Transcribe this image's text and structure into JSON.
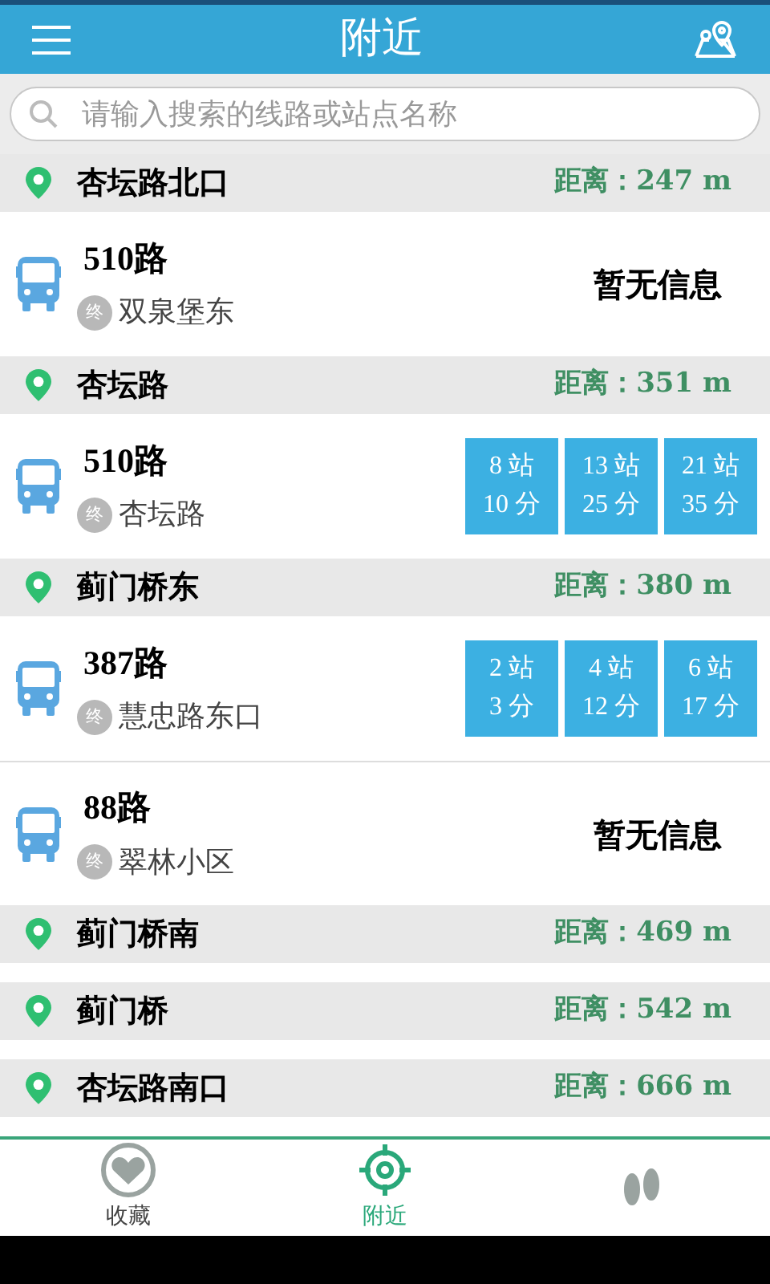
{
  "header": {
    "title": "附近"
  },
  "search": {
    "placeholder": "请输入搜索的线路或站点名称"
  },
  "stations": [
    {
      "name": "杏坛路北口",
      "distance": "距离：247 m",
      "routes": [
        {
          "kind": "text",
          "name": "510路",
          "end_badge": "终",
          "terminus": "双泉堡东",
          "message": "暂无信息"
        }
      ]
    },
    {
      "name": "杏坛路",
      "distance": "距离：351 m",
      "routes": [
        {
          "kind": "eta",
          "name": "510路",
          "end_badge": "终",
          "terminus": "杏坛路",
          "etas": [
            {
              "stops": "8 站",
              "time": "10 分"
            },
            {
              "stops": "13 站",
              "time": "25 分"
            },
            {
              "stops": "21 站",
              "time": "35 分"
            }
          ]
        }
      ]
    },
    {
      "name": "蓟门桥东",
      "distance": "距离：380 m",
      "routes": [
        {
          "kind": "eta",
          "name": "387路",
          "end_badge": "终",
          "terminus": "慧忠路东口",
          "etas": [
            {
              "stops": "2 站",
              "time": "3 分"
            },
            {
              "stops": "4 站",
              "time": "12 分"
            },
            {
              "stops": "6 站",
              "time": "17 分"
            }
          ]
        },
        {
          "kind": "text",
          "name": "88路",
          "end_badge": "终",
          "terminus": "翠林小区",
          "message": "暂无信息"
        }
      ]
    },
    {
      "name": "蓟门桥南",
      "distance": "距离：469 m"
    },
    {
      "name": "蓟门桥",
      "distance": "距离：542 m"
    },
    {
      "name": "杏坛路南口",
      "distance": "距离：666 m"
    }
  ],
  "tabs": [
    {
      "label": "收藏",
      "kind": "favorites",
      "selected": false
    },
    {
      "label": "附近",
      "kind": "nearby",
      "selected": true
    },
    {
      "kind": "footprints",
      "selected": false
    }
  ]
}
